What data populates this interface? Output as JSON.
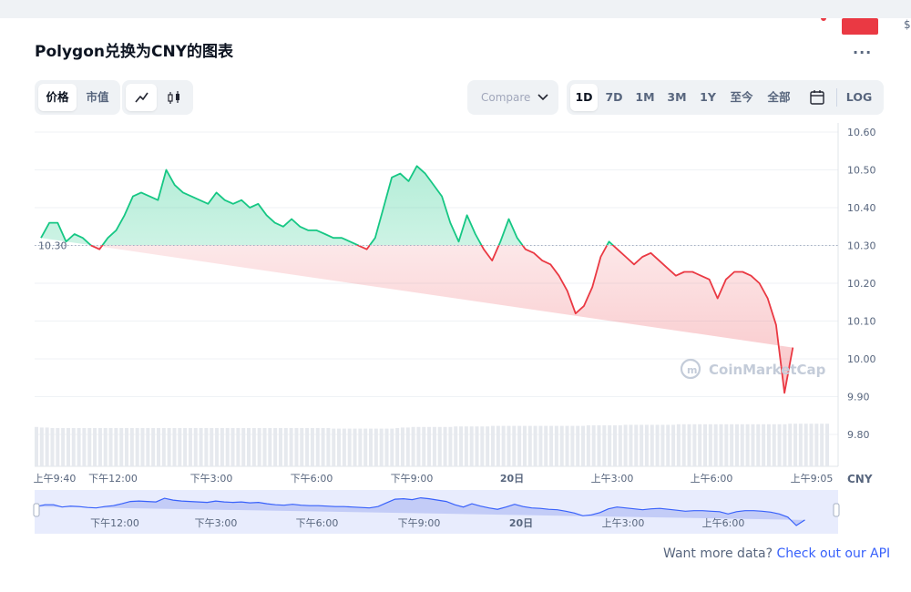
{
  "header": {
    "title": "Polygon兑换为CNY的图表",
    "more_label": "..."
  },
  "controls": {
    "type_tabs": [
      {
        "label": "价格",
        "active": true
      },
      {
        "label": "市值",
        "active": false
      }
    ],
    "view_tabs": [
      {
        "icon": "line-chart-icon",
        "active": true
      },
      {
        "icon": "candlestick-icon",
        "active": false
      }
    ],
    "compare_label": "Compare",
    "compare_icon": "chevron-down-icon",
    "range_tabs": [
      {
        "label": "1D",
        "active": true
      },
      {
        "label": "7D",
        "active": false
      },
      {
        "label": "1M",
        "active": false
      },
      {
        "label": "3M",
        "active": false
      },
      {
        "label": "1Y",
        "active": false
      },
      {
        "label": "至今",
        "active": false
      },
      {
        "label": "全部",
        "active": false
      }
    ],
    "calendar_icon": "calendar-icon",
    "log_label": "LOG"
  },
  "chart_data": {
    "type": "line",
    "currency_label": "CNY",
    "ylim": [
      9.8,
      10.6
    ],
    "y_ticks": [
      "10.60",
      "10.50",
      "10.40",
      "10.30",
      "10.20",
      "10.10",
      "10.00",
      "9.90",
      "9.80"
    ],
    "baseline_value": 10.3,
    "baseline_label": "10.30",
    "current_value_label": "10.03",
    "x_ticks": [
      "上午9:40",
      "下午12:00",
      "下午3:00",
      "下午6:00",
      "下午9:00",
      "20日",
      "上午3:00",
      "上午6:00",
      "上午9:05"
    ],
    "navigator_ticks": [
      "下午12:00",
      "下午3:00",
      "下午6:00",
      "下午9:00",
      "20日",
      "上午3:00",
      "上午6:00"
    ],
    "watermark": "CoinMarketCap",
    "up_color": "#16c784",
    "down_color": "#ea3943",
    "x_hours": [
      0,
      0.25,
      0.5,
      0.75,
      1.0,
      1.25,
      1.5,
      1.75,
      2.0,
      2.25,
      2.5,
      2.75,
      3.0,
      3.25,
      3.5,
      3.75,
      4.0,
      4.25,
      4.5,
      4.75,
      5.0,
      5.25,
      5.5,
      5.75,
      6.0,
      6.25,
      6.5,
      6.75,
      7.0,
      7.25,
      7.5,
      7.75,
      8.0,
      8.25,
      8.5,
      8.75,
      9.0,
      9.25,
      9.5,
      9.75,
      10.0,
      10.25,
      10.5,
      10.75,
      11.0,
      11.25,
      11.5,
      11.75,
      12.0,
      12.25,
      12.5,
      12.75,
      13.0,
      13.25,
      13.5,
      13.75,
      14.0,
      14.25,
      14.5,
      14.75,
      15.0,
      15.25,
      15.5,
      15.75,
      16.0,
      16.25,
      16.5,
      16.75,
      17.0,
      17.25,
      17.5,
      17.75,
      18.0,
      18.25,
      18.5,
      18.75,
      19.0,
      19.25,
      19.5,
      19.75,
      20.0,
      20.25,
      20.5,
      20.75,
      21.0,
      21.25,
      21.5,
      21.75,
      22.0,
      22.25,
      22.5,
      22.75,
      23.0,
      23.25,
      23.42
    ],
    "values": [
      10.32,
      10.36,
      10.36,
      10.31,
      10.33,
      10.32,
      10.3,
      10.29,
      10.32,
      10.34,
      10.38,
      10.43,
      10.44,
      10.43,
      10.42,
      10.5,
      10.46,
      10.44,
      10.43,
      10.42,
      10.41,
      10.44,
      10.42,
      10.41,
      10.42,
      10.4,
      10.41,
      10.38,
      10.36,
      10.35,
      10.37,
      10.35,
      10.34,
      10.34,
      10.33,
      10.32,
      10.32,
      10.31,
      10.3,
      10.29,
      10.32,
      10.4,
      10.48,
      10.49,
      10.47,
      10.51,
      10.49,
      10.46,
      10.43,
      10.36,
      10.31,
      10.38,
      10.33,
      10.29,
      10.26,
      10.31,
      10.37,
      10.32,
      10.29,
      10.28,
      10.26,
      10.25,
      10.22,
      10.18,
      10.12,
      10.14,
      10.19,
      10.27,
      10.31,
      10.29,
      10.27,
      10.25,
      10.27,
      10.28,
      10.26,
      10.24,
      10.22,
      10.23,
      10.23,
      10.22,
      10.21,
      10.16,
      10.21,
      10.23,
      10.23,
      10.22,
      10.2,
      10.16,
      10.09,
      9.91,
      10.03
    ],
    "volume": [
      0.72,
      0.71,
      0.7,
      0.7,
      0.7,
      0.7,
      0.7,
      0.7,
      0.7,
      0.7,
      0.7,
      0.7,
      0.7,
      0.7,
      0.7,
      0.7,
      0.7,
      0.7,
      0.7,
      0.7,
      0.7,
      0.7,
      0.7,
      0.7,
      0.7,
      0.7,
      0.7,
      0.7,
      0.7,
      0.7,
      0.7,
      0.7,
      0.7,
      0.7,
      0.69,
      0.69,
      0.69,
      0.69,
      0.69,
      0.69,
      0.69,
      0.7,
      0.71,
      0.72,
      0.72,
      0.72,
      0.72,
      0.72,
      0.73,
      0.73,
      0.73,
      0.73,
      0.74,
      0.74,
      0.74,
      0.74,
      0.74,
      0.74,
      0.74,
      0.74,
      0.74,
      0.74,
      0.74,
      0.75,
      0.75,
      0.75,
      0.75,
      0.76,
      0.76,
      0.76,
      0.76,
      0.76,
      0.76,
      0.77,
      0.77,
      0.77,
      0.77,
      0.77,
      0.77,
      0.77,
      0.77,
      0.77,
      0.77,
      0.77,
      0.77,
      0.77,
      0.78,
      0.78,
      0.78,
      0.78,
      0.78
    ],
    "grid": true
  },
  "footer": {
    "prefix": "Want more data?",
    "link_text": "Check out our API"
  }
}
